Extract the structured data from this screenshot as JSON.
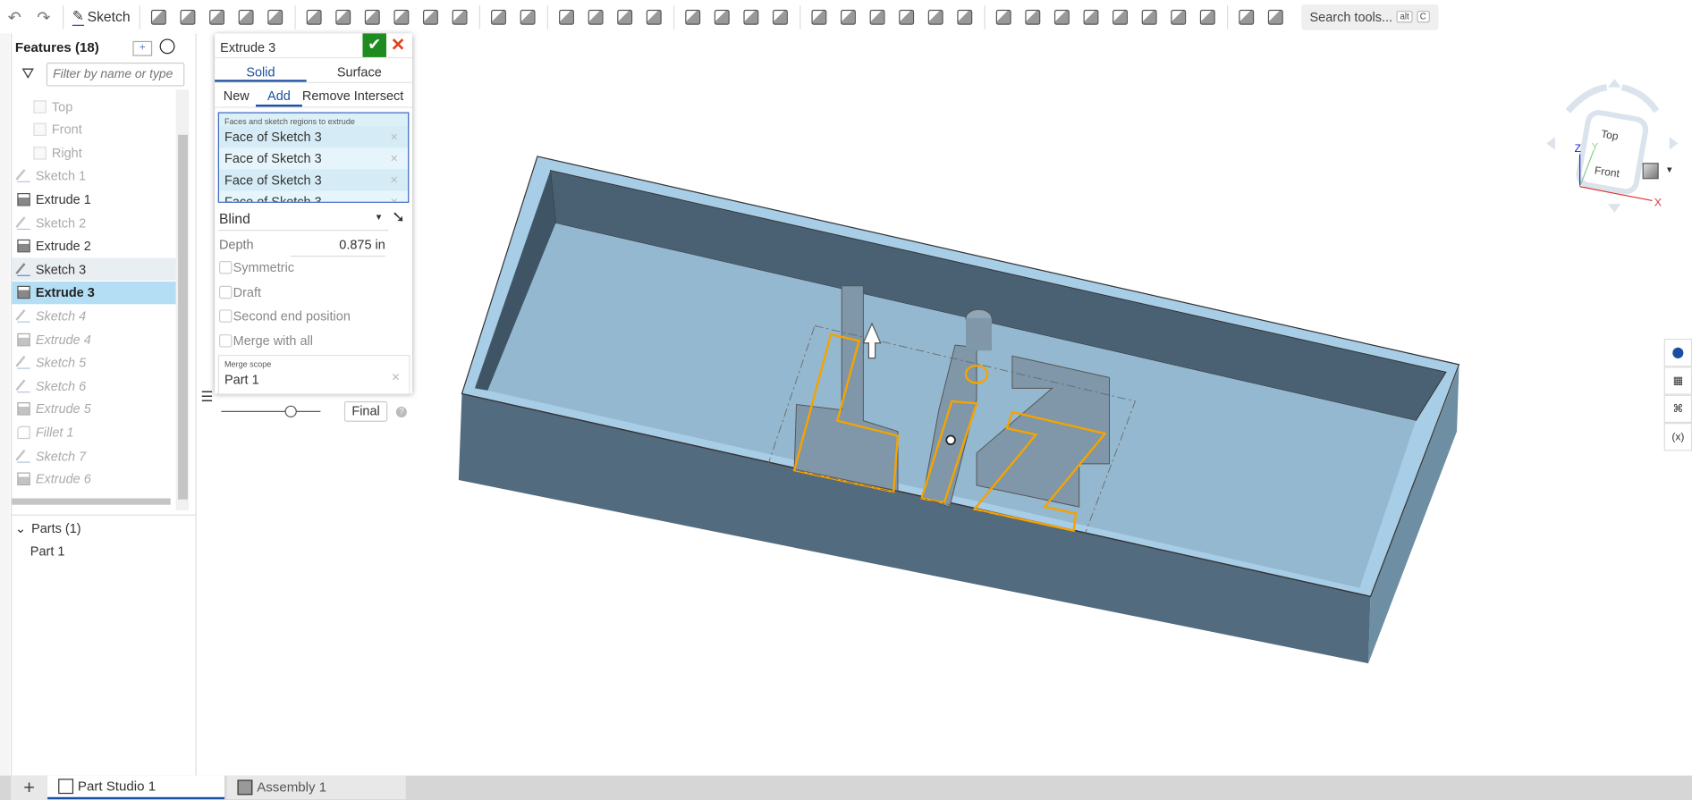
{
  "toolbar": {
    "undo_icon": "undo-icon",
    "redo_icon": "redo-icon",
    "sketch_label": "Sketch",
    "groups": [
      [
        "extrude",
        "revolve",
        "sweep",
        "loft",
        "thicken"
      ],
      [
        "fillet",
        "chamfer",
        "draft",
        "rib",
        "shell",
        "hole"
      ],
      [
        "linear-pattern",
        "mirror"
      ],
      [
        "boolean",
        "split",
        "transform",
        "delete-part"
      ],
      [
        "modify-fillet",
        "delete-face",
        "move-face",
        "replace-face"
      ],
      [
        "plane",
        "helix",
        "mate-connector",
        "variable-history",
        "variable",
        "assembly-parts"
      ],
      [
        "sheet-metal",
        "flange",
        "hem",
        "tab",
        "corner-break",
        "joint",
        "form",
        "finish-sheet-metal"
      ],
      [
        "featurescript",
        "add-custom-feature"
      ]
    ],
    "search_label": "Search tools...",
    "search_keys": [
      "alt",
      "C"
    ]
  },
  "features": {
    "title": "Features (18)",
    "filter_placeholder": "Filter by name or type",
    "items": [
      {
        "label": "Top",
        "type": "plane",
        "state": "dim"
      },
      {
        "label": "Front",
        "type": "plane",
        "state": "dim"
      },
      {
        "label": "Right",
        "type": "plane",
        "state": "dim"
      },
      {
        "label": "Sketch 1",
        "type": "sketch",
        "state": "dim"
      },
      {
        "label": "Extrude 1",
        "type": "extrude",
        "state": "normal"
      },
      {
        "label": "Sketch 2",
        "type": "sketch",
        "state": "dim"
      },
      {
        "label": "Extrude 2",
        "type": "extrude",
        "state": "normal"
      },
      {
        "label": "Sketch 3",
        "type": "sketch",
        "state": "hover"
      },
      {
        "label": "Extrude 3",
        "type": "extrude",
        "state": "selected"
      },
      {
        "label": "Sketch 4",
        "type": "sketch",
        "state": "rolled"
      },
      {
        "label": "Extrude 4",
        "type": "extrude",
        "state": "rolled"
      },
      {
        "label": "Sketch 5",
        "type": "sketch",
        "state": "rolled"
      },
      {
        "label": "Sketch 6",
        "type": "sketch",
        "state": "rolled"
      },
      {
        "label": "Extrude 5",
        "type": "extrude",
        "state": "rolled"
      },
      {
        "label": "Fillet 1",
        "type": "fillet",
        "state": "rolled"
      },
      {
        "label": "Sketch 7",
        "type": "sketch",
        "state": "rolled"
      },
      {
        "label": "Extrude 6",
        "type": "extrude",
        "state": "rolled"
      }
    ],
    "parts_header": "Parts (1)",
    "parts": [
      "Part 1"
    ]
  },
  "dialog": {
    "title": "Extrude 3",
    "body_tabs": [
      "Solid",
      "Surface"
    ],
    "active_body_tab": "Solid",
    "op_tabs": [
      "New",
      "Add",
      "Remove",
      "Intersect"
    ],
    "active_op_tab": "Add",
    "selection_label": "Faces and sketch regions to extrude",
    "selections": [
      "Face of Sketch 3",
      "Face of Sketch 3",
      "Face of Sketch 3",
      "Face of Sketch 3"
    ],
    "end_type": "Blind",
    "depth_label": "Depth",
    "depth_value": "0.875 in",
    "options": [
      {
        "label": "Symmetric",
        "checked": false
      },
      {
        "label": "Draft",
        "checked": false
      },
      {
        "label": "Second end position",
        "checked": false
      },
      {
        "label": "Merge with all",
        "checked": false
      }
    ],
    "merge_scope_label": "Merge scope",
    "merge_scope_value": "Part 1",
    "final_label": "Final",
    "accent": "#1a4fa0",
    "ok_color": "#1e8c1e",
    "cancel_color": "#e0421b"
  },
  "viewcube": {
    "top": "Top",
    "front": "Front",
    "x": "X",
    "y": "Y",
    "z": "Z"
  },
  "bottom_tabs": [
    {
      "label": "Part Studio 1",
      "icon": "part-studio-icon",
      "active": true
    },
    {
      "label": "Assembly 1",
      "icon": "assembly-icon",
      "active": false
    }
  ],
  "colors": {
    "selection_highlight": "#f5a300",
    "model": "#8fb4cc"
  }
}
